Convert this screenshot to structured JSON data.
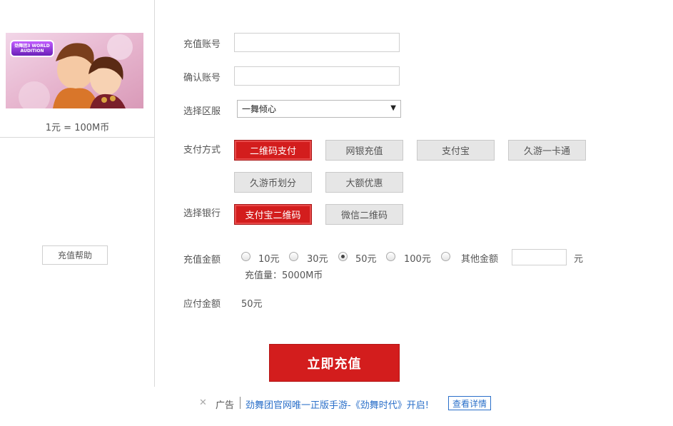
{
  "sidebar": {
    "game_image": "劲舞团3 WORLD AUDITION",
    "rate": "1元 = 100M币",
    "help_label": "充值帮助"
  },
  "form": {
    "account_label": "充值账号",
    "account_value": "",
    "confirm_label": "确认账号",
    "confirm_value": "",
    "server_label": "选择区服",
    "server_selected": "一舞倾心",
    "payment_label": "支付方式",
    "payment_methods": [
      {
        "label": "二维码支付",
        "selected": true
      },
      {
        "label": "网银充值",
        "selected": false
      },
      {
        "label": "支付宝",
        "selected": false
      },
      {
        "label": "久游一卡通",
        "selected": false
      },
      {
        "label": "久游币划分",
        "selected": false
      },
      {
        "label": "大额优惠",
        "selected": false
      }
    ],
    "bank_label": "选择银行",
    "banks": [
      {
        "label": "支付宝二维码",
        "selected": true
      },
      {
        "label": "微信二维码",
        "selected": false
      }
    ],
    "amount_label": "充值金额",
    "amounts": [
      {
        "label": "10元",
        "checked": false
      },
      {
        "label": "30元",
        "checked": false
      },
      {
        "label": "50元",
        "checked": true
      },
      {
        "label": "100元",
        "checked": false
      },
      {
        "label": "其他金额",
        "checked": false
      }
    ],
    "other_amount_value": "",
    "other_amount_unit": "元",
    "recharge_quantity": "充值量：5000M币",
    "payable_label": "应付金额",
    "payable_value": "50元",
    "submit_label": "立即充值"
  },
  "ad": {
    "close_icon": "close-icon",
    "tag": "广告",
    "text": "劲舞团官网唯一正版手游-《劲舞时代》开启!",
    "detail_label": "查看详情"
  },
  "colors": {
    "accent_red": "#d31d1d",
    "link_blue": "#2a6fc9",
    "button_gray": "#e6e6e6"
  }
}
